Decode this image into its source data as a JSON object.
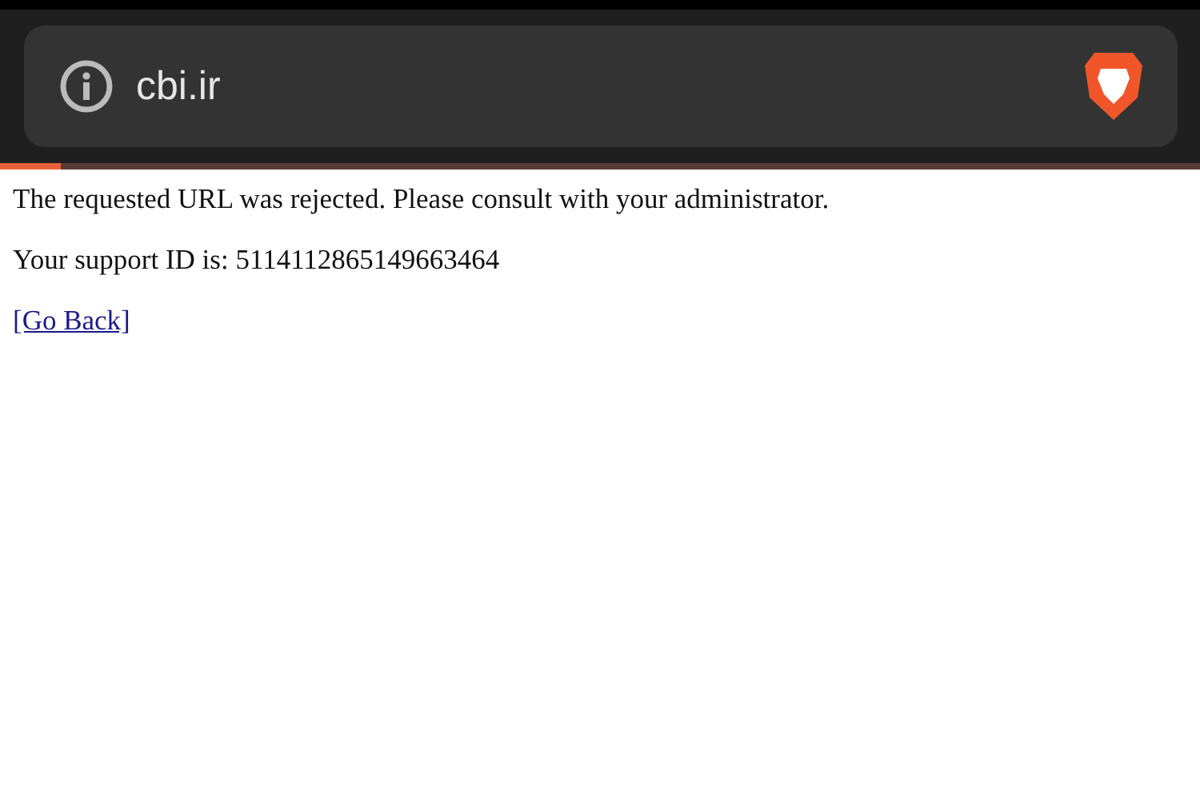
{
  "address_bar": {
    "url": "cbi.ir"
  },
  "load_progress": {
    "level": 0.05
  },
  "page": {
    "message": "The requested URL was rejected. Please consult with your administrator.",
    "support_id": "Your support ID is: 5114112865149663464",
    "link": "[Go Back]"
  }
}
